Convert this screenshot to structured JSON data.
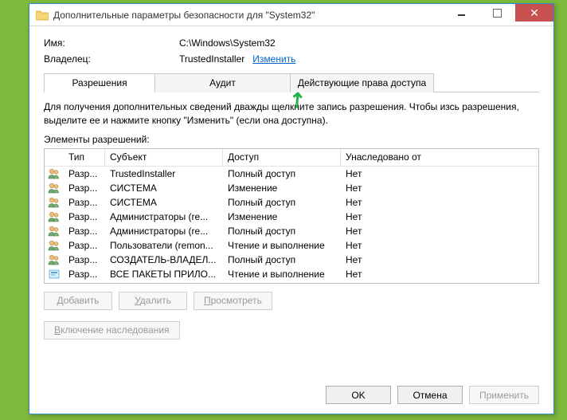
{
  "window": {
    "title": "Дополнительные параметры безопасности  для \"System32\""
  },
  "fields": {
    "name_label": "Имя:",
    "name_value": "C:\\Windows\\System32",
    "owner_label": "Владелец:",
    "owner_value": "TrustedInstaller",
    "change_link": "Изменить"
  },
  "tabs": {
    "permissions": "Разрешения",
    "audit": "Аудит",
    "effective": "Действующие права доступа"
  },
  "description": "Для получения дополнительных сведений дважды щелкните запись разрешения. Чтобы изсь разрешения, выделите ее и нажмите кнопку \"Изменить\" (если она доступна).",
  "section_title": "Элементы разрешений:",
  "columns": {
    "type": "Тип",
    "subject": "Субъект",
    "access": "Доступ",
    "inherited": "Унаследовано от"
  },
  "rows": [
    {
      "icon": "group",
      "type": "Разр...",
      "subject": "TrustedInstaller",
      "access": "Полный доступ",
      "inherited": "Нет"
    },
    {
      "icon": "group",
      "type": "Разр...",
      "subject": "СИСТЕМА",
      "access": "Изменение",
      "inherited": "Нет"
    },
    {
      "icon": "group",
      "type": "Разр...",
      "subject": "СИСТЕМА",
      "access": "Полный доступ",
      "inherited": "Нет"
    },
    {
      "icon": "group",
      "type": "Разр...",
      "subject": "Администраторы (re...",
      "access": "Изменение",
      "inherited": "Нет"
    },
    {
      "icon": "group",
      "type": "Разр...",
      "subject": "Администраторы (re...",
      "access": "Полный доступ",
      "inherited": "Нет"
    },
    {
      "icon": "group",
      "type": "Разр...",
      "subject": "Пользователи (remon...",
      "access": "Чтение и выполнение",
      "inherited": "Нет"
    },
    {
      "icon": "group",
      "type": "Разр...",
      "subject": "СОЗДАТЕЛЬ-ВЛАДЕЛ...",
      "access": "Полный доступ",
      "inherited": "Нет"
    },
    {
      "icon": "package",
      "type": "Разр...",
      "subject": "ВСЕ ПАКЕТЫ ПРИЛО...",
      "access": "Чтение и выполнение",
      "inherited": "Нет"
    }
  ],
  "buttons": {
    "add": "Добавить",
    "remove": "Удалить",
    "view": "Просмотреть",
    "enable_inherit": "Включение наследования",
    "ok": "OK",
    "cancel": "Отмена",
    "apply": "Применить"
  }
}
